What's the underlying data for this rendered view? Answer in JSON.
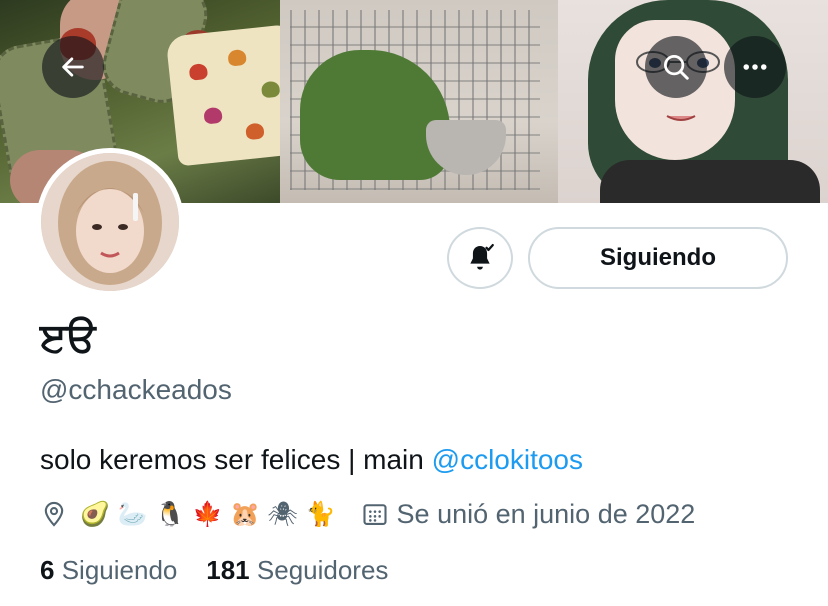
{
  "profile": {
    "display_name": "ੲੳ",
    "handle": "@cchackeados",
    "bio_text": "solo keremos ser felices | main ",
    "bio_mention": "@cclokitoos",
    "location_emojis": "🥑 🦢 🐧 🍁 🐹 🕷 🐈",
    "joined": "Se unió en junio de 2022"
  },
  "actions": {
    "follow_label": "Siguiendo"
  },
  "stats": {
    "following_count": "6",
    "following_label": "Siguiendo",
    "followers_count": "181",
    "followers_label": "Seguidores"
  },
  "icons": {
    "back": "arrow-left-icon",
    "search": "search-icon",
    "more": "more-dots-icon",
    "bell": "bell-subscribed-icon",
    "location": "location-pin-icon",
    "calendar": "calendar-icon"
  },
  "colors": {
    "text": "#0f1419",
    "secondary": "#536471",
    "link": "#1d9bf0",
    "border": "#cfd9de"
  }
}
